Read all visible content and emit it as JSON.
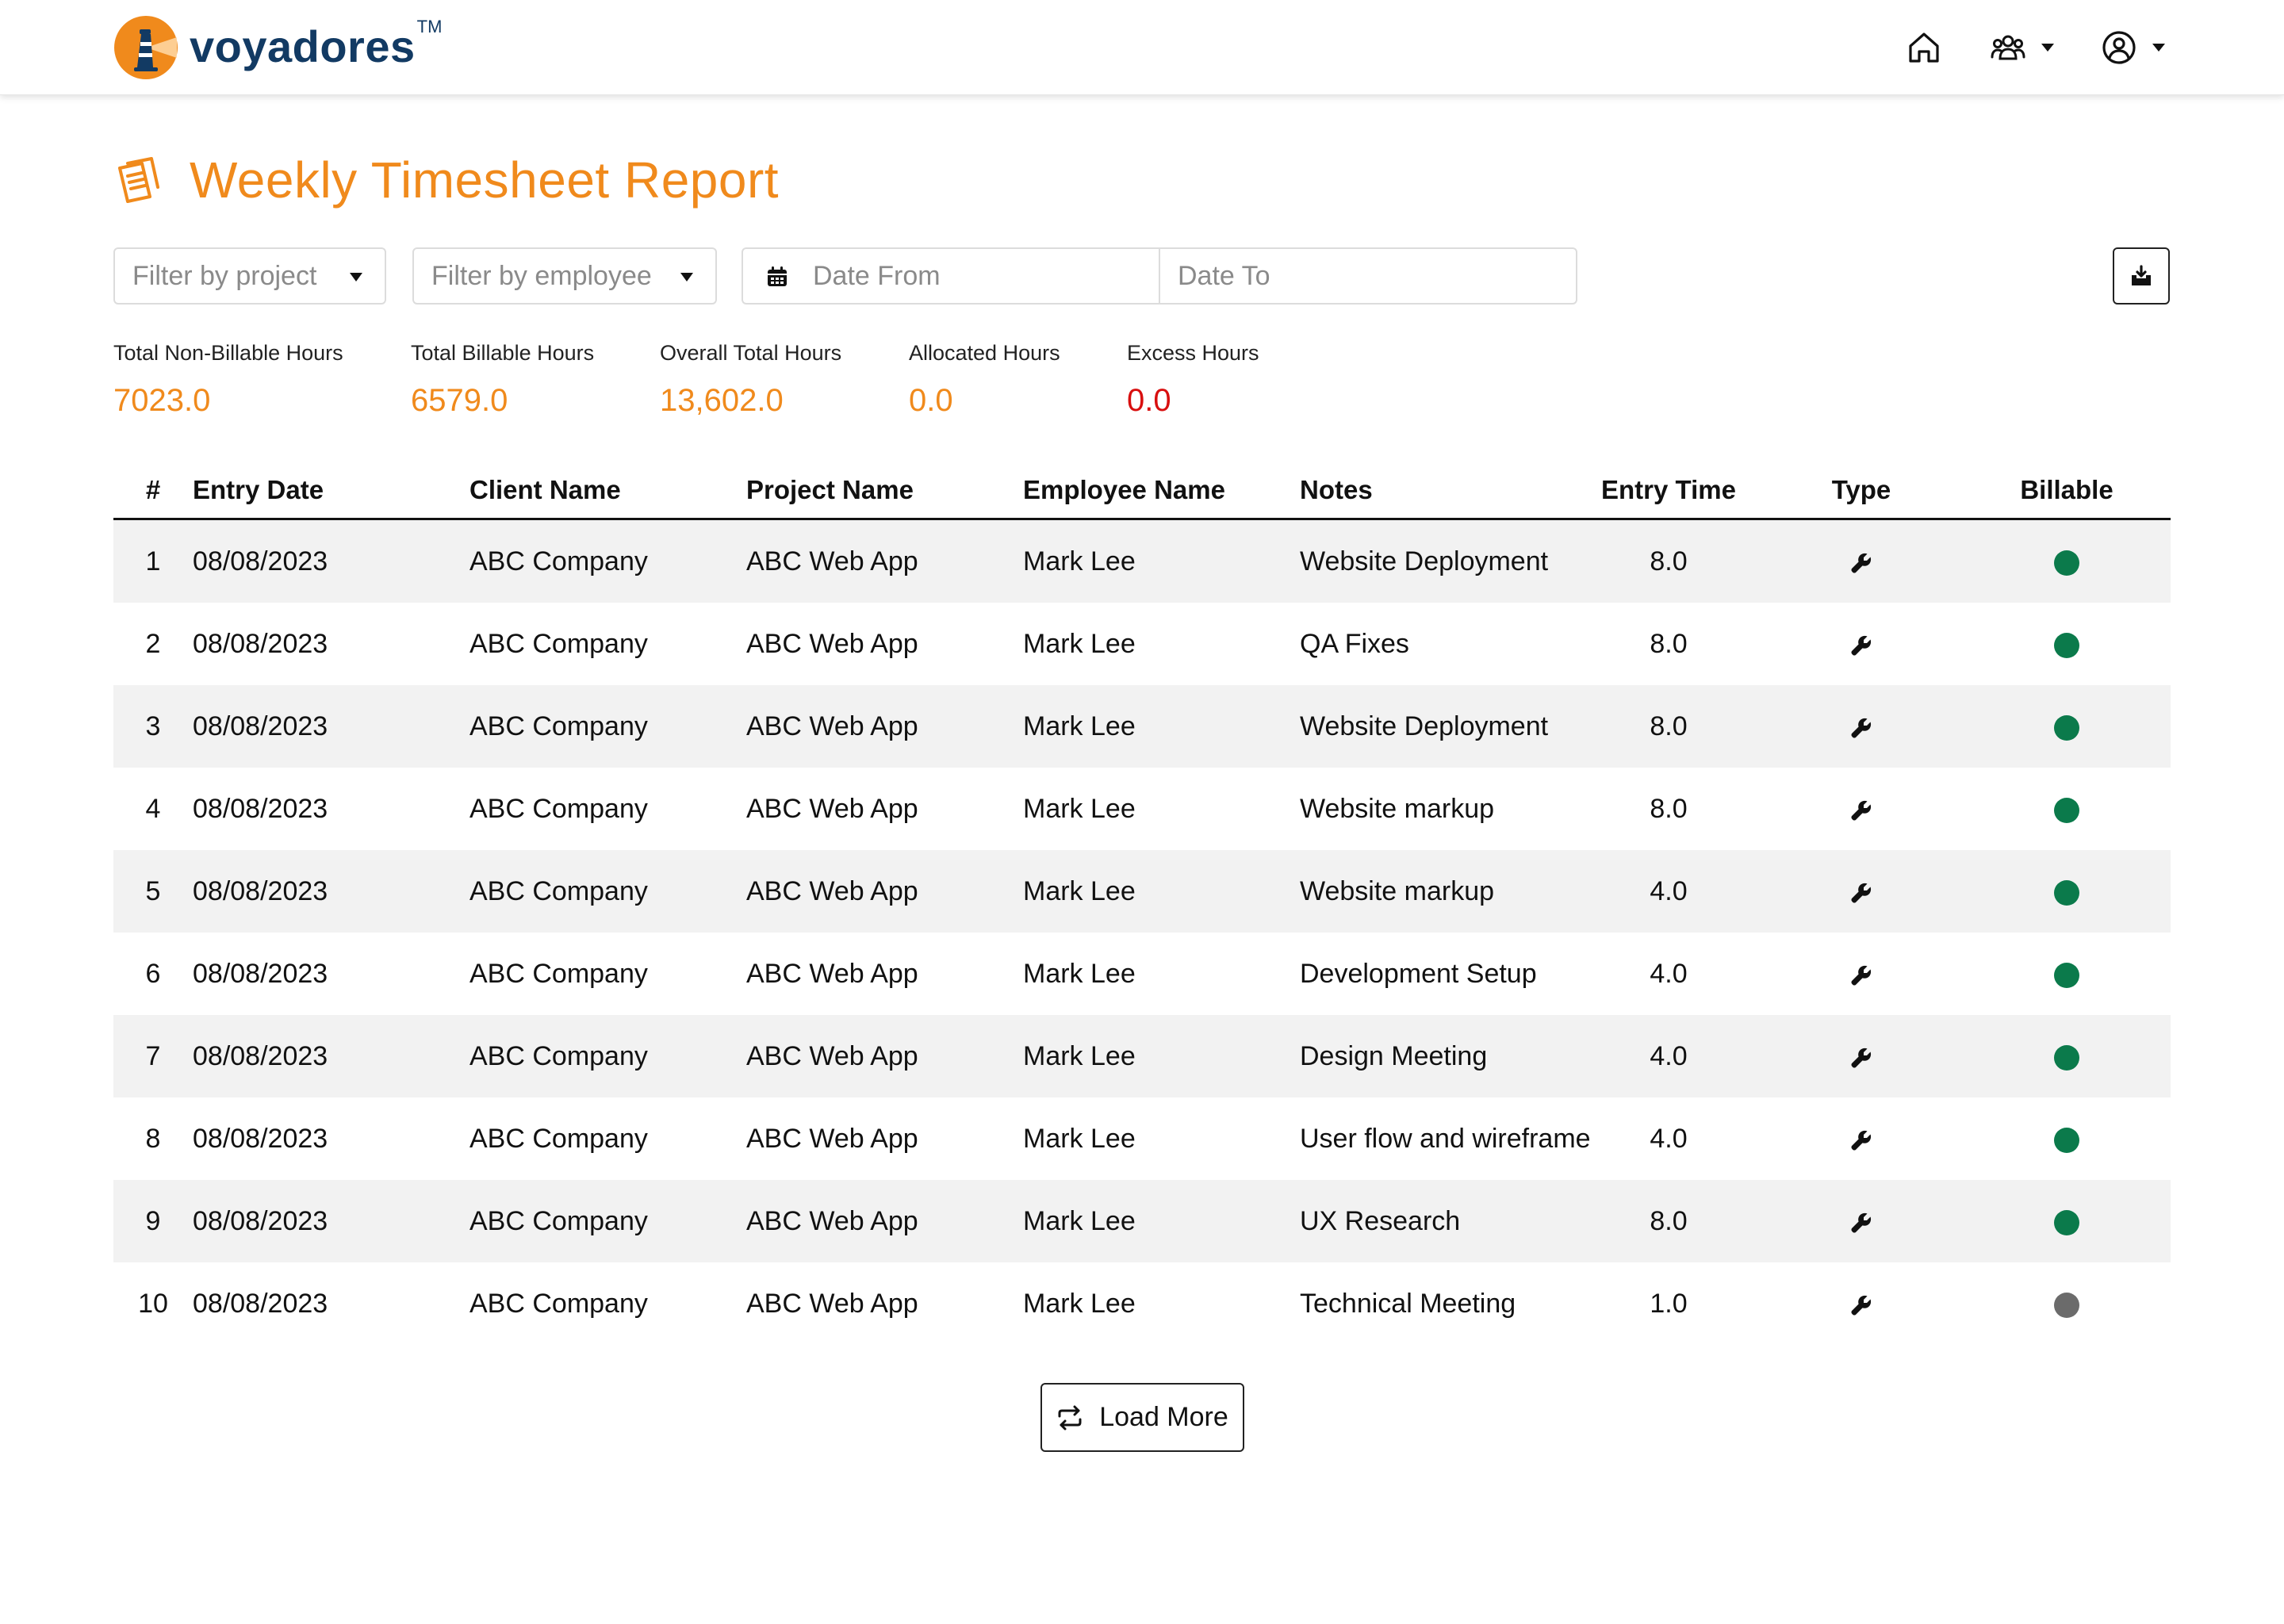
{
  "brand": {
    "name": "voyadores",
    "trademark": "TM",
    "colors": {
      "primary": "#123a63",
      "accent": "#f08a1c"
    }
  },
  "nav": {
    "icons": [
      "home-icon",
      "users-icon",
      "user-circle-icon"
    ]
  },
  "page": {
    "title": "Weekly Timesheet Report",
    "icon": "documents-icon"
  },
  "filters": {
    "project_placeholder": "Filter by project",
    "employee_placeholder": "Filter by employee",
    "date_from_placeholder": "Date From",
    "date_to_placeholder": "Date To"
  },
  "stats": [
    {
      "label": "Total Non-Billable Hours",
      "value": "7023.0",
      "color": "#f08a1c"
    },
    {
      "label": "Total Billable Hours",
      "value": "6579.0",
      "color": "#f08a1c"
    },
    {
      "label": "Overall Total Hours",
      "value": "13,602.0",
      "color": "#f08a1c"
    },
    {
      "label": "Allocated Hours",
      "value": "0.0",
      "color": "#f08a1c"
    },
    {
      "label": "Excess Hours",
      "value": "0.0",
      "color": "#d80f0f"
    }
  ],
  "table": {
    "headers": [
      "#",
      "Entry Date",
      "Client Name",
      "Project Name",
      "Employee Name",
      "Notes",
      "Entry Time",
      "Type",
      "Billable"
    ],
    "billable_colors": {
      "yes": "#0b7a4b",
      "no": "#6b6b6b"
    },
    "rows": [
      {
        "num": "1",
        "date": "08/08/2023",
        "client": "ABC Company",
        "project": "ABC Web App",
        "employee": "Mark Lee",
        "notes": "Website Deployment",
        "time": "8.0",
        "type": "wrench-icon",
        "billable": true
      },
      {
        "num": "2",
        "date": "08/08/2023",
        "client": "ABC Company",
        "project": "ABC Web App",
        "employee": "Mark Lee",
        "notes": "QA Fixes",
        "time": "8.0",
        "type": "wrench-icon",
        "billable": true
      },
      {
        "num": "3",
        "date": "08/08/2023",
        "client": "ABC Company",
        "project": "ABC Web App",
        "employee": "Mark Lee",
        "notes": "Website Deployment",
        "time": "8.0",
        "type": "wrench-icon",
        "billable": true
      },
      {
        "num": "4",
        "date": "08/08/2023",
        "client": "ABC Company",
        "project": "ABC Web App",
        "employee": "Mark Lee",
        "notes": "Website markup",
        "time": "8.0",
        "type": "wrench-icon",
        "billable": true
      },
      {
        "num": "5",
        "date": "08/08/2023",
        "client": "ABC Company",
        "project": "ABC Web App",
        "employee": "Mark Lee",
        "notes": "Website markup",
        "time": "4.0",
        "type": "wrench-icon",
        "billable": true
      },
      {
        "num": "6",
        "date": "08/08/2023",
        "client": "ABC Company",
        "project": "ABC Web App",
        "employee": "Mark Lee",
        "notes": "Development Setup",
        "time": "4.0",
        "type": "wrench-icon",
        "billable": true
      },
      {
        "num": "7",
        "date": "08/08/2023",
        "client": "ABC Company",
        "project": "ABC Web App",
        "employee": "Mark Lee",
        "notes": "Design Meeting",
        "time": "4.0",
        "type": "wrench-icon",
        "billable": true
      },
      {
        "num": "8",
        "date": "08/08/2023",
        "client": "ABC Company",
        "project": "ABC Web App",
        "employee": "Mark Lee",
        "notes": "User flow and wireframe",
        "time": "4.0",
        "type": "wrench-icon",
        "billable": true
      },
      {
        "num": "9",
        "date": "08/08/2023",
        "client": "ABC Company",
        "project": "ABC Web App",
        "employee": "Mark Lee",
        "notes": "UX Research",
        "time": "8.0",
        "type": "wrench-icon",
        "billable": true
      },
      {
        "num": "10",
        "date": "08/08/2023",
        "client": "ABC Company",
        "project": "ABC Web App",
        "employee": "Mark Lee",
        "notes": "Technical Meeting",
        "time": "1.0",
        "type": "wrench-icon",
        "billable": false
      }
    ]
  },
  "load_more": {
    "label": "Load More",
    "icon": "repeat-icon"
  }
}
